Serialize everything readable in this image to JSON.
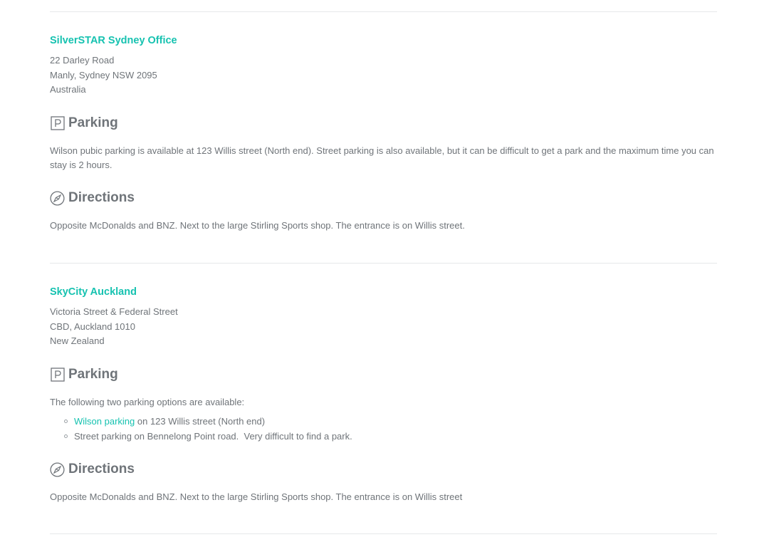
{
  "offices": [
    {
      "name": "SilverSTAR Sydney Office",
      "address": [
        "22 Darley Road",
        "Manly, Sydney NSW 2095",
        "Australia"
      ],
      "parking_heading": "Parking",
      "parking_text": "Wilson pubic parking is available at 123 Willis street (North end). Street parking is also available, but it can be difficult to get a park and the maximum time you can stay is 2 hours.",
      "directions_heading": "Directions",
      "directions_text": "Opposite McDonalds and BNZ. Next to the large Stirling Sports shop. The entrance is on Willis street."
    },
    {
      "name": "SkyCity Auckland",
      "address": [
        "Victoria Street & Federal Street",
        "CBD, Auckland 1010",
        "New Zealand"
      ],
      "parking_heading": "Parking",
      "parking_intro": "The following two parking options are available:",
      "parking_options": [
        {
          "link": "Wilson parking",
          "text": " on 123 Willis street (North end)"
        },
        {
          "text": "Street parking on Bennelong Point road.  Very difficult to find a park."
        }
      ],
      "directions_heading": "Directions",
      "directions_text": "Opposite McDonalds and BNZ. Next to the large Stirling Sports shop. The entrance is on Willis street"
    }
  ],
  "icons": {
    "parking": "parking-icon",
    "directions": "compass-icon"
  },
  "colors": {
    "accent": "#16c2b0",
    "text": "#6f7479",
    "divider": "#e6e8ea"
  }
}
